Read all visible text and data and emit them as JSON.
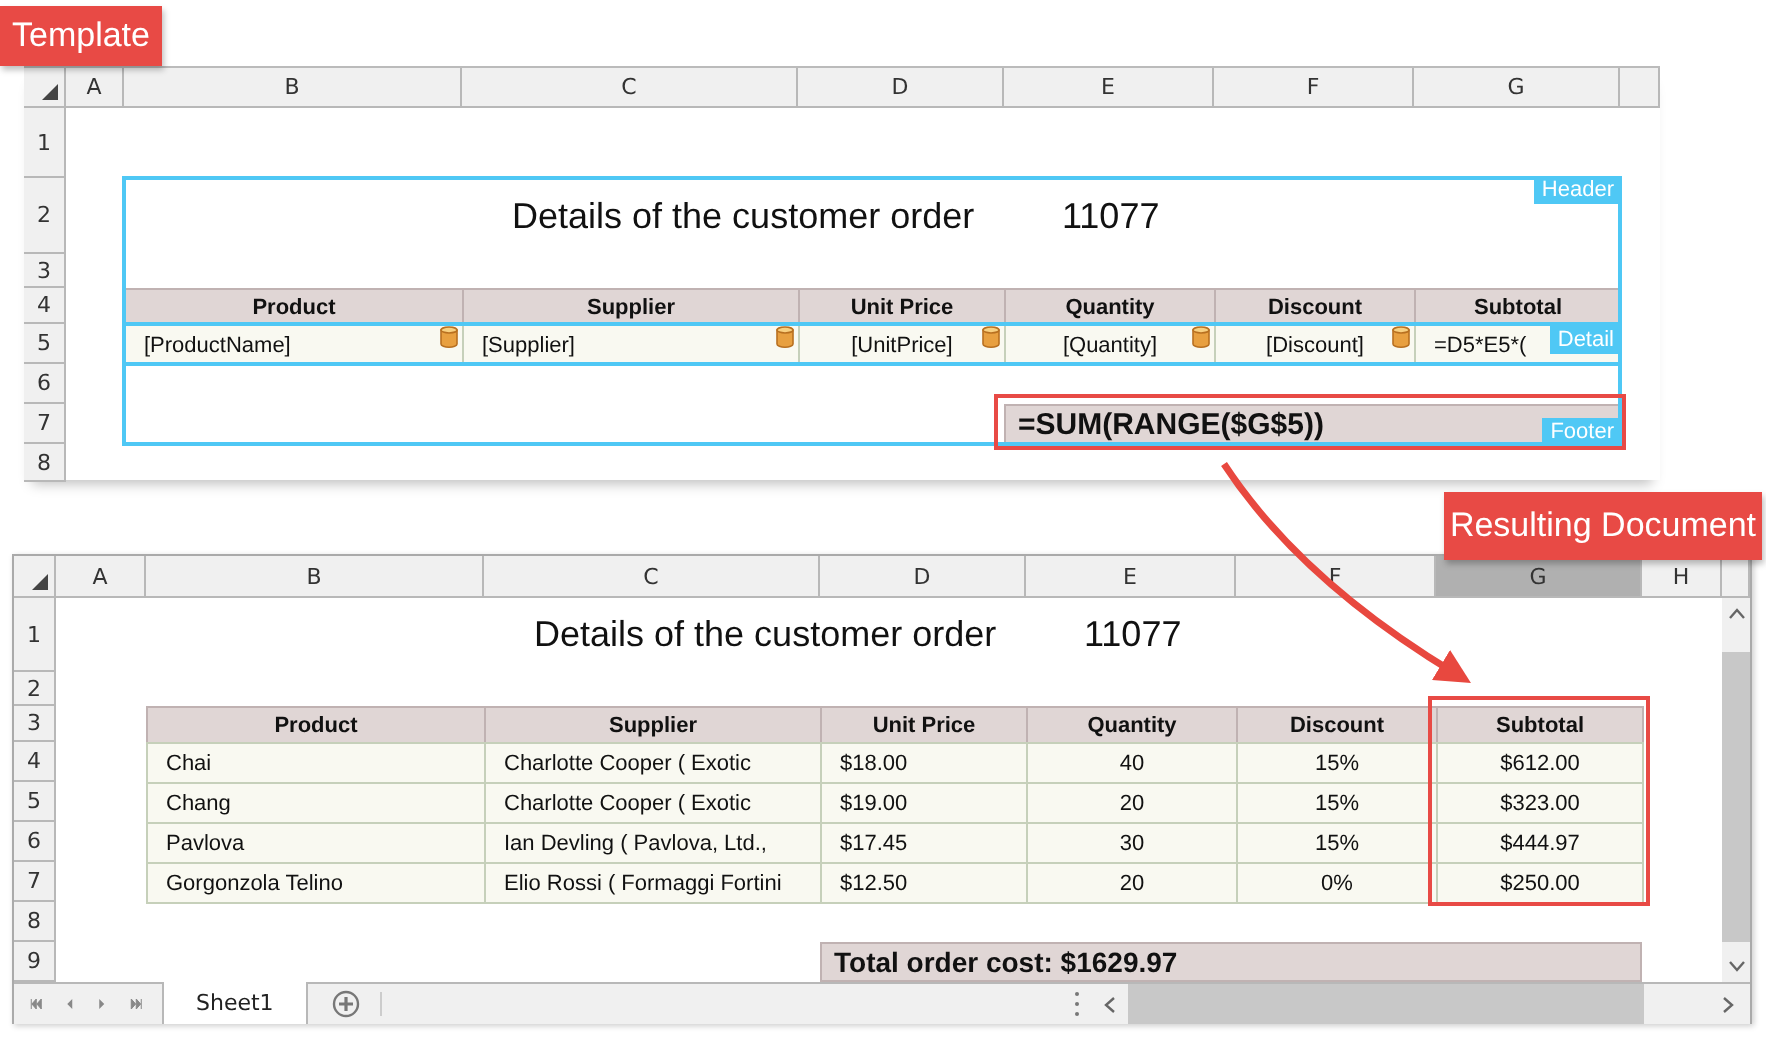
{
  "template_label": "Template",
  "template": {
    "columns": [
      {
        "label": "A",
        "selected": false
      },
      {
        "label": "B",
        "selected": false
      },
      {
        "label": "C",
        "selected": false
      },
      {
        "label": "D",
        "selected": false
      },
      {
        "label": "E",
        "selected": false
      },
      {
        "label": "F",
        "selected": false
      },
      {
        "label": "G",
        "selected": false
      }
    ],
    "rows": [
      "1",
      "2",
      "3",
      "4",
      "5",
      "6",
      "7",
      "8"
    ],
    "title": "Details of the customer order",
    "order_no": "11077",
    "headers": [
      "Product",
      "Supplier",
      "Unit Price",
      "Quantity",
      "Discount",
      "Subtotal"
    ],
    "fields": [
      {
        "text": "[ProductName]",
        "bound": true
      },
      {
        "text": "[Supplier]",
        "bound": true
      },
      {
        "text": "[UnitPrice]",
        "bound": true
      },
      {
        "text": "[Quantity]",
        "bound": true
      },
      {
        "text": "[Discount]",
        "bound": true
      },
      {
        "text": "=D5*E5*(",
        "bound": false
      }
    ],
    "footer_formula": "=SUM(RANGE($G$5))",
    "bands": [
      {
        "kind": "header",
        "label": "Header"
      },
      {
        "kind": "detail",
        "label": "Detail"
      },
      {
        "kind": "footer",
        "label": "Footer"
      }
    ]
  },
  "result_label": "Resulting Document",
  "result": {
    "columns": [
      {
        "label": "A",
        "selected": false
      },
      {
        "label": "B",
        "selected": false
      },
      {
        "label": "C",
        "selected": false
      },
      {
        "label": "D",
        "selected": false
      },
      {
        "label": "E",
        "selected": false
      },
      {
        "label": "F",
        "selected": false
      },
      {
        "label": "G",
        "selected": true
      },
      {
        "label": "H",
        "selected": false
      }
    ],
    "rows": [
      "1",
      "2",
      "3",
      "4",
      "5",
      "6",
      "7",
      "8",
      "9"
    ],
    "title": "Details of the customer order",
    "order_no": "11077",
    "headers": [
      "Product",
      "Supplier",
      "Unit Price",
      "Quantity",
      "Discount",
      "Subtotal"
    ],
    "data": [
      [
        "Chai",
        "Charlotte Cooper ( Exotic",
        "$18.00",
        "40",
        "15%",
        "$612.00"
      ],
      [
        "Chang",
        "Charlotte Cooper ( Exotic",
        "$19.00",
        "20",
        "15%",
        "$323.00"
      ],
      [
        "Pavlova",
        "Ian Devling ( Pavlova, Ltd.,",
        "$17.45",
        "30",
        "15%",
        "$444.97"
      ],
      [
        "Gorgonzola Telino",
        "Elio Rossi ( Formaggi Fortini",
        "$12.50",
        "20",
        "0%",
        "$250.00"
      ]
    ],
    "total": "Total order cost: $1629.97",
    "sheet_tabs": [
      {
        "label": "Sheet1",
        "selected": true
      }
    ]
  }
}
